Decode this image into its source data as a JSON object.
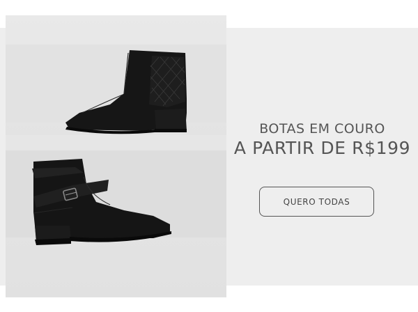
{
  "promo": {
    "headline_line1": "BOTAS EM COURO",
    "headline_line2": "A PARTIR DE R$199",
    "cta_label": "QUERO TODAS"
  },
  "colors": {
    "text": "#555555",
    "boot": "#141414",
    "panel": "#eeeeee"
  }
}
